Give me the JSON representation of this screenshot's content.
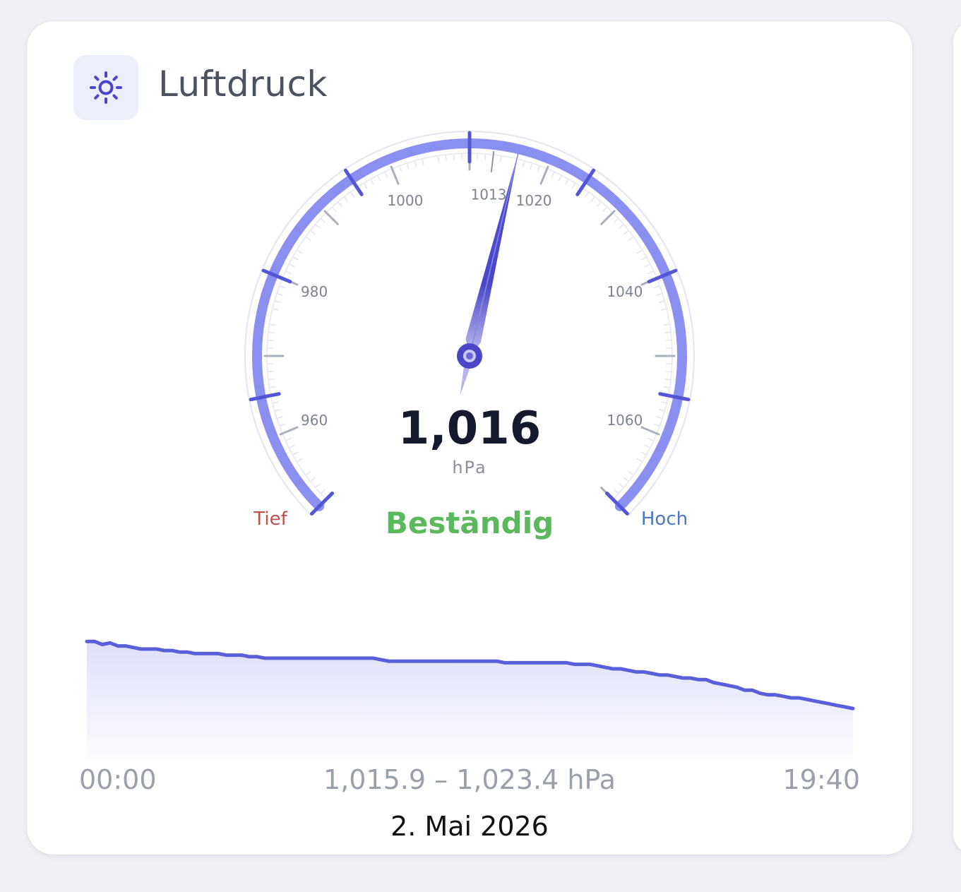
{
  "card": {
    "icon": "sun-gear-icon",
    "title": "Luftdruck"
  },
  "gauge": {
    "value": 1016,
    "value_text": "1,016",
    "unit": "hPa",
    "min": 950,
    "max": 1070,
    "tick_labels": [
      960,
      980,
      1000,
      1013,
      1020,
      1040,
      1060
    ],
    "low_label": "Tief",
    "high_label": "Hoch",
    "trend": "Beständig",
    "colors": {
      "arc": "#8b8ff0",
      "major_tick": "#5556d6",
      "needle": "#4b46c8",
      "low": "#c0504d",
      "high": "#4a78c2",
      "trend": "#5cb85c"
    }
  },
  "history": {
    "start_time": "00:00",
    "end_time": "19:40",
    "range_text": "1,015.9 – 1,023.4 hPa",
    "date": "2. Mai 2026",
    "y_min": 1015.9,
    "y_max": 1023.4,
    "line_color": "#5a5fd9",
    "values": [
      1023.3,
      1023.3,
      1023.1,
      1023.2,
      1023.0,
      1023.0,
      1022.9,
      1022.8,
      1022.8,
      1022.8,
      1022.7,
      1022.7,
      1022.6,
      1022.6,
      1022.5,
      1022.5,
      1022.5,
      1022.5,
      1022.4,
      1022.4,
      1022.4,
      1022.3,
      1022.3,
      1022.2,
      1022.2,
      1022.2,
      1022.2,
      1022.2,
      1022.2,
      1022.2,
      1022.2,
      1022.2,
      1022.2,
      1022.2,
      1022.2,
      1022.2,
      1022.2,
      1022.2,
      1022.1,
      1022.0,
      1022.0,
      1022.0,
      1022.0,
      1022.0,
      1022.0,
      1022.0,
      1022.0,
      1022.0,
      1022.0,
      1022.0,
      1022.0,
      1022.0,
      1022.0,
      1022.0,
      1021.9,
      1021.9,
      1021.9,
      1021.9,
      1021.9,
      1021.9,
      1021.9,
      1021.9,
      1021.9,
      1021.8,
      1021.8,
      1021.8,
      1021.7,
      1021.6,
      1021.5,
      1021.5,
      1021.4,
      1021.3,
      1021.3,
      1021.2,
      1021.1,
      1021.1,
      1021.0,
      1020.9,
      1020.9,
      1020.8,
      1020.8,
      1020.6,
      1020.5,
      1020.4,
      1020.3,
      1020.1,
      1020.1,
      1019.9,
      1019.8,
      1019.8,
      1019.7,
      1019.6,
      1019.6,
      1019.5,
      1019.4,
      1019.3,
      1019.2,
      1019.1,
      1019.0,
      1018.9
    ]
  }
}
